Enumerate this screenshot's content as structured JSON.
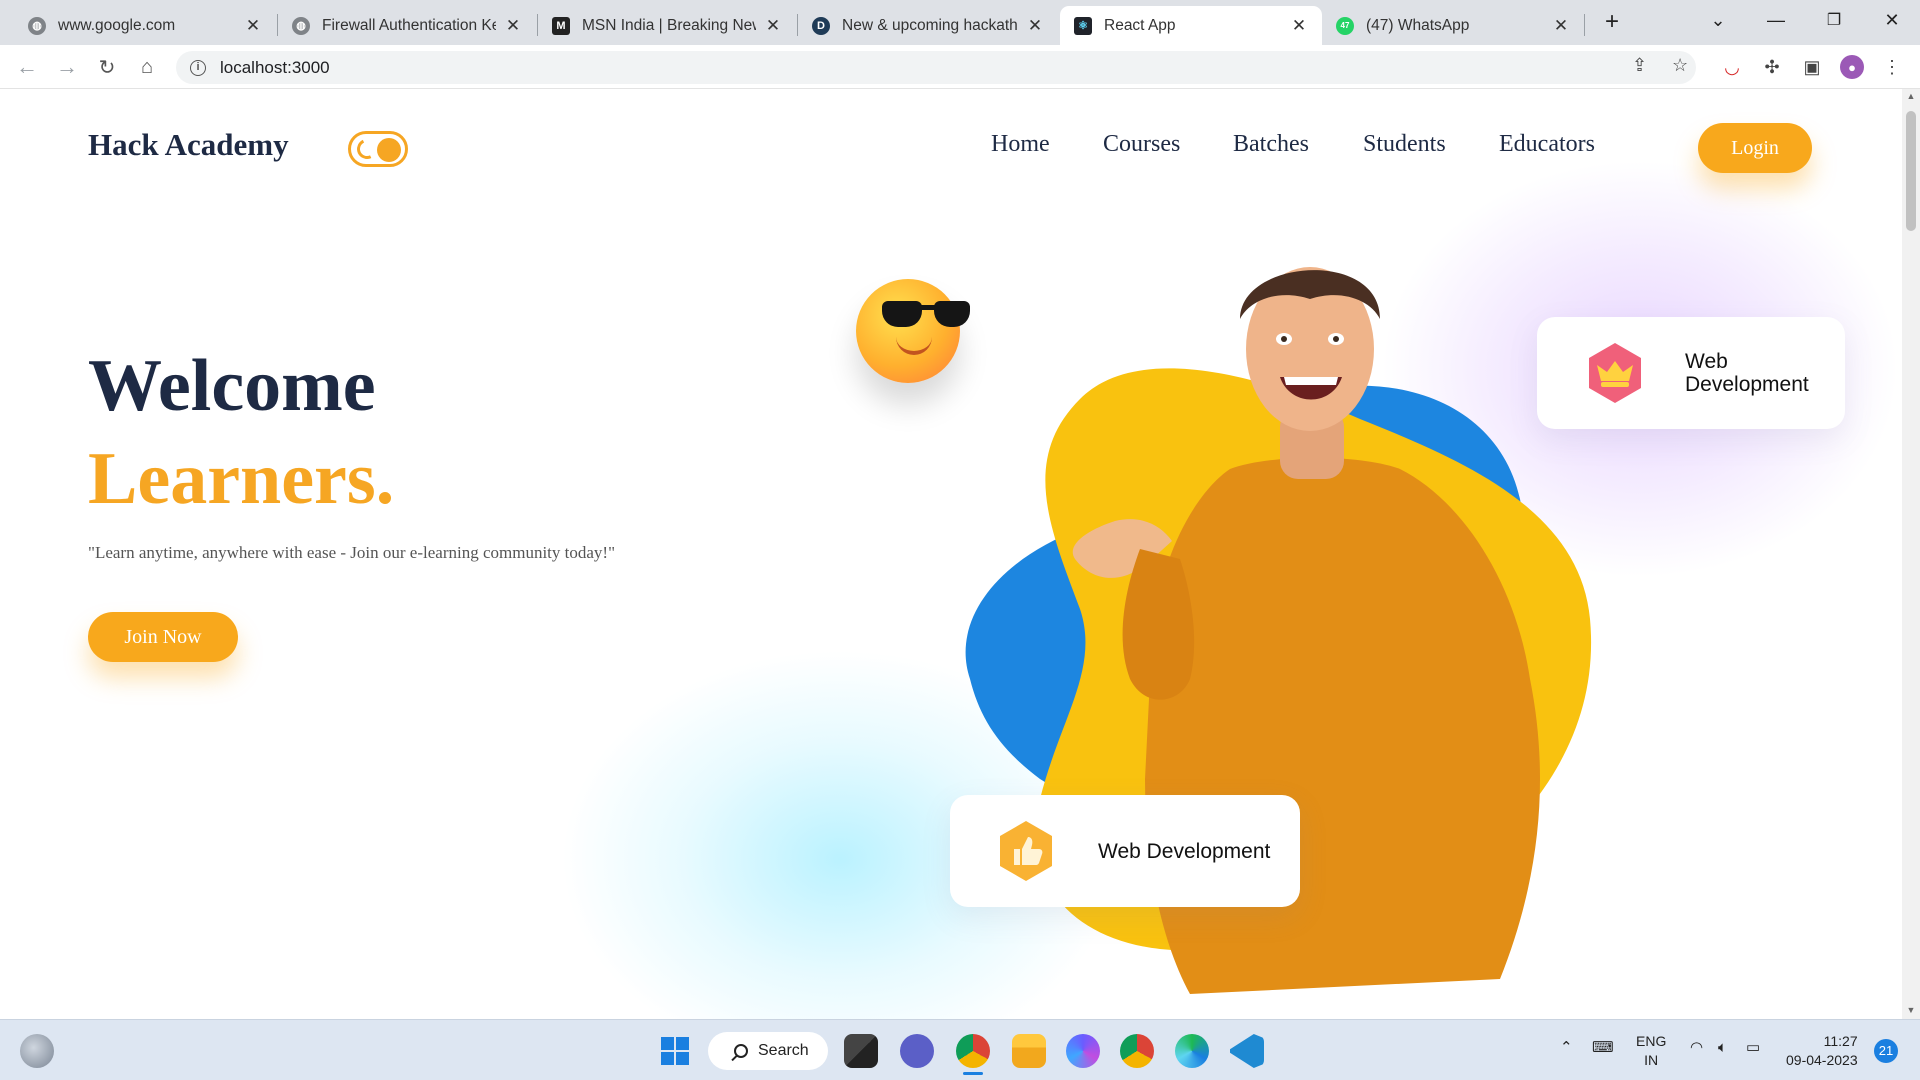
{
  "browser": {
    "tabs": [
      {
        "label": "www.google.com",
        "icon": "globe-icon",
        "active": false
      },
      {
        "label": "Firewall Authentication Keep",
        "icon": "globe-icon",
        "active": false
      },
      {
        "label": "MSN India | Breaking News",
        "icon": "msn-icon",
        "active": false
      },
      {
        "label": "New & upcoming hackathons",
        "icon": "devfolio-icon",
        "active": false
      },
      {
        "label": "React App",
        "icon": "react-icon",
        "active": true
      },
      {
        "label": "(47) WhatsApp",
        "icon": "whatsapp-icon",
        "active": false
      }
    ],
    "new_tab": "+",
    "whatsapp_badge": "47",
    "url": "localhost:3000"
  },
  "site": {
    "brand": "Hack Academy",
    "nav": [
      "Home",
      "Courses",
      "Batches",
      "Students",
      "Educators"
    ],
    "login": "Login",
    "hero_line1": "Welcome",
    "hero_line2": "Learners.",
    "tagline": "\"Learn anytime, anywhere with ease - Join our e-learning community today!\"",
    "cta": "Join Now",
    "card_top": "Web Development",
    "card_bottom": "Web Development"
  },
  "taskbar": {
    "search": "Search",
    "language_line1": "ENG",
    "language_line2": "IN",
    "time": "11:27",
    "date": "09-04-2023",
    "notifications": "21"
  },
  "colors": {
    "accent": "#f6a623",
    "brand_dark": "#1e2a44",
    "blob_yellow": "#f9c20f",
    "blob_blue": "#1d86e0",
    "sweater": "#e28e16"
  }
}
